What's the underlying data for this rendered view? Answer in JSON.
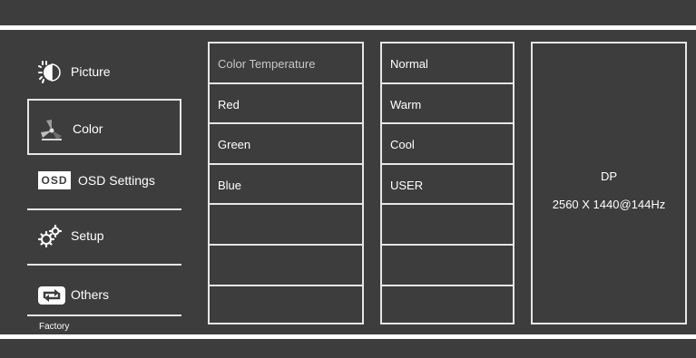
{
  "menu": {
    "items": [
      {
        "label": "Picture",
        "icon": "picture-icon"
      },
      {
        "label": "Color",
        "icon": "color-icon"
      },
      {
        "label": "OSD Settings",
        "icon": "osd-icon",
        "icon_text": "OSD"
      },
      {
        "label": "Setup",
        "icon": "gears-icon"
      },
      {
        "label": "Others",
        "icon": "loop-arrows-icon"
      }
    ],
    "footer": "Factory"
  },
  "color_options": [
    "Color Temperature",
    "Red",
    "Green",
    "Blue",
    "",
    "",
    ""
  ],
  "temperature_options": [
    "Normal",
    "Warm",
    "Cool",
    "USER",
    "",
    "",
    ""
  ],
  "info": {
    "source": "DP",
    "resolution": "2560 X 1440@144Hz"
  },
  "colors": {
    "background": "#3d3d3d",
    "border": "#e6e6e6",
    "text": "#ffffff"
  }
}
